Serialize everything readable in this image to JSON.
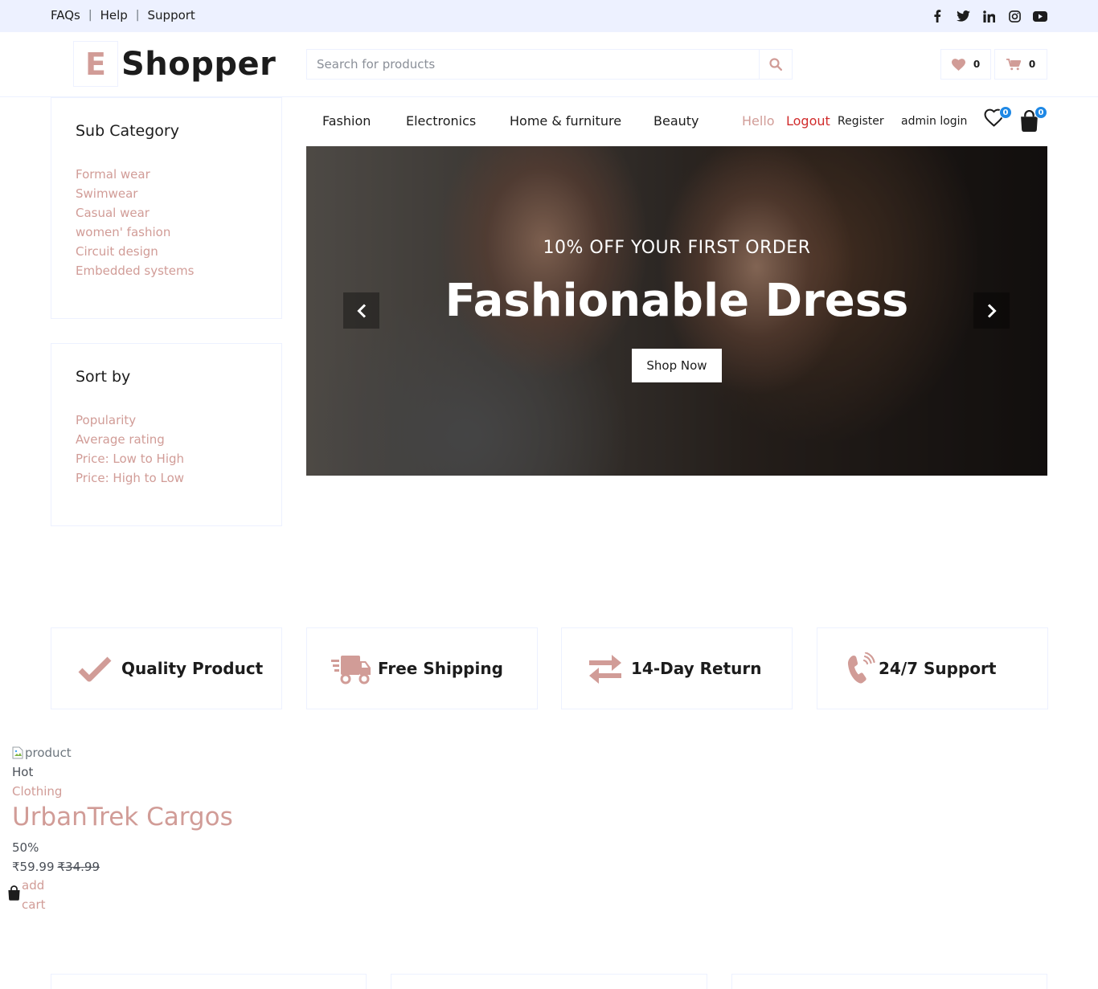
{
  "topbar": {
    "links": [
      "FAQs",
      "Help",
      "Support"
    ],
    "social_icons": [
      "facebook-icon",
      "twitter-icon",
      "linkedin-icon",
      "instagram-icon",
      "youtube-icon"
    ]
  },
  "header": {
    "logo_letter": "E",
    "logo_text": "Shopper",
    "search_placeholder": "Search for products",
    "wishlist_count": "0",
    "cart_count": "0"
  },
  "sidebar": {
    "subcategory_title": "Sub Category",
    "subcategories": [
      "Formal wear",
      "Swimwear",
      "Casual wear",
      "women' fashion",
      "Circuit design",
      "Embedded systems"
    ],
    "sort_title": "Sort by",
    "sort_options": [
      "Popularity",
      "Average rating",
      "Price: Low to High",
      "Price: High to Low"
    ]
  },
  "nav": {
    "categories": [
      "Fashion",
      "Electronics",
      "Home & furniture",
      "Beauty"
    ],
    "hello": "Hello",
    "logout": "Logout",
    "register": "Register",
    "admin_login": "admin login",
    "wishlist_badge": "0",
    "cart_badge": "0"
  },
  "hero": {
    "subtitle": "10% OFF YOUR FIRST ORDER",
    "title": "Fashionable Dress",
    "button": "Shop Now"
  },
  "features": [
    {
      "label": "Quality Product",
      "icon": "check-icon"
    },
    {
      "label": "Free Shipping",
      "icon": "shipping-truck-icon"
    },
    {
      "label": "14-Day Return",
      "icon": "exchange-arrows-icon"
    },
    {
      "label": "24/7 Support",
      "icon": "phone-volume-icon"
    }
  ],
  "product": {
    "image_alt": "product",
    "badge": "Hot",
    "category": "Clothing",
    "name": "UrbanTrek Cargos",
    "discount": "50%",
    "price": "₹59.99",
    "old_price": "₹34.99",
    "add_to_cart_line1": "add",
    "add_to_cart_line2": "cart"
  },
  "colors": {
    "accent": "#D19C97",
    "topbar_bg": "#EDF1FF",
    "dark": "#1C1C1C",
    "badge_blue": "#1E88E5",
    "logout_red": "#D12C2C"
  }
}
